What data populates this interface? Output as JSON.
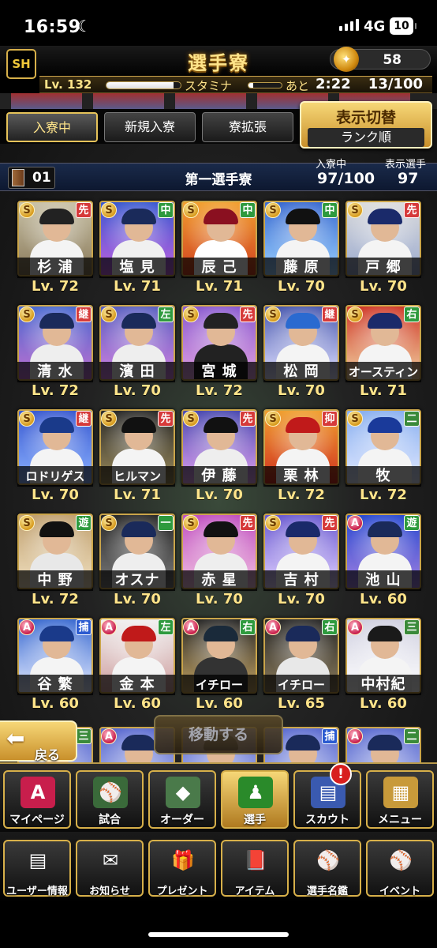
{
  "status_bar": {
    "time": "16:59",
    "network": "4G",
    "battery": "10"
  },
  "header": {
    "logo": "SH",
    "title": "選手寮",
    "currency_value": "58"
  },
  "player": {
    "level": "Lv. 132",
    "exp_fraction": 0.9,
    "stamina_label": "スタミナ",
    "stamina_fraction": 0.15,
    "remaining_label": "あと",
    "remaining_time": "2:22",
    "stamina_count": "13/100"
  },
  "tabs": [
    {
      "label": "入寮中",
      "active": true
    },
    {
      "label": "新規入寮",
      "active": false
    },
    {
      "label": "寮拡張",
      "active": false
    }
  ],
  "toggle": {
    "title": "表示切替",
    "value": "ランク順"
  },
  "dorm": {
    "number": "01",
    "name": "第一選手寮",
    "capacity_label": "入寮中",
    "capacity_value": "97/100",
    "display_label": "表示選手",
    "display_value": "97"
  },
  "cards": [
    {
      "name": "杉 浦",
      "level": "Lv. 72",
      "rank": "S",
      "position": "先",
      "pos_color": "#d63a3a",
      "bg": "linear-gradient(#c9c2a8,#8a7a5a)",
      "uni": "#f4f4f4",
      "capc": "#222"
    },
    {
      "name": "塩 見",
      "level": "Lv. 71",
      "rank": "S",
      "position": "中",
      "pos_color": "#2e9a3e",
      "bg": "linear-gradient(#3a5ad0,#c060e0)",
      "uni": "#f0f0f0",
      "capc": "#1a2a5a"
    },
    {
      "name": "辰 己",
      "level": "Lv. 71",
      "rank": "S",
      "position": "中",
      "pos_color": "#2e9a3e",
      "bg": "linear-gradient(#f2a030,#d04020)",
      "uni": "#fff",
      "capc": "#8a1020"
    },
    {
      "name": "藤 原",
      "level": "Lv. 70",
      "rank": "S",
      "position": "中",
      "pos_color": "#2e9a3e",
      "bg": "linear-gradient(#3a6ad0,#9ad0ff)",
      "uni": "#f4f4f4",
      "capc": "#111"
    },
    {
      "name": "戸 郷",
      "level": "Lv. 70",
      "rank": "S",
      "position": "先",
      "pos_color": "#d63a3a",
      "bg": "linear-gradient(#dcdcdc,#9aaad0)",
      "uni": "#f4f4f4",
      "capc": "#1a2a6a"
    },
    {
      "name": "清 水",
      "level": "Lv. 72",
      "rank": "S",
      "position": "継",
      "pos_color": "#d63a3a",
      "bg": "linear-gradient(#4a6ad0,#c070d0)",
      "uni": "#eee",
      "capc": "#1a2a5a"
    },
    {
      "name": "濱 田",
      "level": "Lv. 70",
      "rank": "S",
      "position": "左",
      "pos_color": "#2e9a3e",
      "bg": "linear-gradient(#5a60c0,#d080e0)",
      "uni": "#eee",
      "capc": "#1a2a5a"
    },
    {
      "name": "宮 城",
      "level": "Lv. 72",
      "rank": "S",
      "position": "先",
      "pos_color": "#d63a3a",
      "bg": "linear-gradient(#8a5ad0,#e0a0e0)",
      "uni": "#222",
      "capc": "#222"
    },
    {
      "name": "松 岡",
      "level": "Lv. 70",
      "rank": "S",
      "position": "継",
      "pos_color": "#d63a3a",
      "bg": "linear-gradient(#4a5ab0,#e0e0ff)",
      "uni": "#f4f4f4",
      "capc": "#2a6ad0"
    },
    {
      "name": "オースティン",
      "level": "Lv. 71",
      "rank": "S",
      "position": "右",
      "pos_color": "#2e9a3e",
      "bg": "linear-gradient(#d03a2a,#f0d0a0)",
      "uni": "#f4f4f4",
      "capc": "#1a2a6a"
    },
    {
      "name": "ロドリゲス",
      "level": "Lv. 70",
      "rank": "S",
      "position": "継",
      "pos_color": "#d63a3a",
      "bg": "linear-gradient(#3a5ad0,#8ab0ff)",
      "uni": "#f4f4f4",
      "capc": "#1a3a8a"
    },
    {
      "name": "ヒルマン",
      "level": "Lv. 71",
      "rank": "S",
      "position": "先",
      "pos_color": "#d63a3a",
      "bg": "linear-gradient(#2a2a2a,#9a8a5a)",
      "uni": "#f4f4f4",
      "capc": "#111"
    },
    {
      "name": "伊 藤",
      "level": "Lv. 70",
      "rank": "S",
      "position": "先",
      "pos_color": "#d63a3a",
      "bg": "linear-gradient(#4a4ab0,#e0a0f0)",
      "uni": "#eee",
      "capc": "#111"
    },
    {
      "name": "栗 林",
      "level": "Lv. 72",
      "rank": "S",
      "position": "抑",
      "pos_color": "#d63a3a",
      "bg": "linear-gradient(#f0a030,#d03020)",
      "uni": "#f4f4f4",
      "capc": "#c01a1a"
    },
    {
      "name": "牧",
      "level": "Lv. 72",
      "rank": "S",
      "position": "二",
      "pos_color": "#3a8a3a",
      "bg": "linear-gradient(#8ab0f0,#e0e8ff)",
      "uni": "#f4f4f4",
      "capc": "#1a3a9a"
    },
    {
      "name": "中 野",
      "level": "Lv. 72",
      "rank": "S",
      "position": "遊",
      "pos_color": "#2e9a3e",
      "bg": "linear-gradient(#c0a070,#f0e0c0)",
      "uni": "#e8e8e8",
      "capc": "#111"
    },
    {
      "name": "オスナ",
      "level": "Lv. 70",
      "rank": "S",
      "position": "一",
      "pos_color": "#2e9a3e",
      "bg": "linear-gradient(#2a2a2a,#7a7a7a)",
      "uni": "#eee",
      "capc": "#1a2a5a"
    },
    {
      "name": "赤 星",
      "level": "Lv. 70",
      "rank": "S",
      "position": "先",
      "pos_color": "#d63a3a",
      "bg": "linear-gradient(#c050c0,#f0c0e0)",
      "uni": "#eee",
      "capc": "#111"
    },
    {
      "name": "吉 村",
      "level": "Lv. 70",
      "rank": "S",
      "position": "先",
      "pos_color": "#d63a3a",
      "bg": "linear-gradient(#6a5ad0,#e0d0ff)",
      "uni": "#f4f4f4",
      "capc": "#1a2a6a"
    },
    {
      "name": "池 山",
      "level": "Lv. 60",
      "rank": "A",
      "position": "遊",
      "pos_color": "#2e9a3e",
      "bg": "linear-gradient(#2a4ad0,#a080e0)",
      "uni": "#f4f4f4",
      "capc": "#1a2a5a"
    },
    {
      "name": "谷 繁",
      "level": "Lv. 60",
      "rank": "A",
      "position": "捕",
      "pos_color": "#2a5ad0",
      "bg": "linear-gradient(#3a6ad0,#e0e8ff)",
      "uni": "#f4f4f4",
      "capc": "#1a3a8a"
    },
    {
      "name": "金 本",
      "level": "Lv. 60",
      "rank": "A",
      "position": "左",
      "pos_color": "#2e9a3e",
      "bg": "linear-gradient(#f0f0f0,#d0a0a0)",
      "uni": "#f4f4f4",
      "capc": "#c01a1a"
    },
    {
      "name": "イチロー",
      "level": "Lv. 60",
      "rank": "A",
      "position": "右",
      "pos_color": "#2e9a3e",
      "bg": "linear-gradient(#2a2a2a,#c0a060)",
      "uni": "#333",
      "capc": "#1a2a3a"
    },
    {
      "name": "イチロー",
      "level": "Lv. 65",
      "rank": "A",
      "position": "右",
      "pos_color": "#2e9a3e",
      "bg": "linear-gradient(#2a2a2a,#8a7a5a)",
      "uni": "#e8e8e8",
      "capc": "#1a2a5a"
    },
    {
      "name": "中村紀",
      "level": "Lv. 60",
      "rank": "A",
      "position": "三",
      "pos_color": "#3a8a3a",
      "bg": "linear-gradient(#d0d0e0,#ffffff)",
      "uni": "#f4f4f4",
      "capc": "#1a1a1a"
    }
  ],
  "partial_cards": [
    {
      "rank": "S",
      "position": "三",
      "pos_color": "#3a8a3a"
    },
    {
      "rank": "A",
      "position": "",
      "pos_color": "#2e9a3e"
    },
    {
      "rank": "",
      "position": "",
      "pos_color": "#2e9a3e"
    },
    {
      "rank": "",
      "position": "捕",
      "pos_color": "#2a5ad0"
    },
    {
      "rank": "A",
      "position": "二",
      "pos_color": "#3a8a3a"
    }
  ],
  "actions": {
    "back": "戻る",
    "move": "移動する"
  },
  "nav": [
    {
      "label": "マイページ",
      "icon": "A",
      "icon_name": "mypage-icon",
      "color": "#c81e4c"
    },
    {
      "label": "試合",
      "icon": "⚾",
      "icon_name": "stadium-icon",
      "color": "#3a6a3a"
    },
    {
      "label": "オーダー",
      "icon": "◆",
      "icon_name": "field-order-icon",
      "color": "#4a7a4a"
    },
    {
      "label": "選手",
      "icon": "♟",
      "icon_name": "player-icon",
      "color": "#2a8a2a"
    },
    {
      "label": "スカウト",
      "icon": "▤",
      "icon_name": "scout-icon",
      "color": "#3a5ab0"
    },
    {
      "label": "メニュー",
      "icon": "▦",
      "icon_name": "menu-icon",
      "color": "#c89a3a"
    }
  ],
  "scout_badge": "!",
  "sub_nav": [
    {
      "label": "ユーザー情報",
      "icon": "▤",
      "icon_name": "user-info-icon"
    },
    {
      "label": "お知らせ",
      "icon": "✉",
      "icon_name": "notice-icon"
    },
    {
      "label": "プレゼント",
      "icon": "🎁",
      "icon_name": "present-icon"
    },
    {
      "label": "アイテム",
      "icon": "📕",
      "icon_name": "item-icon"
    },
    {
      "label": "選手名鑑",
      "icon": "⚾",
      "icon_name": "player-directory-icon"
    },
    {
      "label": "イベント",
      "icon": "⚾",
      "icon_name": "event-icon"
    }
  ]
}
